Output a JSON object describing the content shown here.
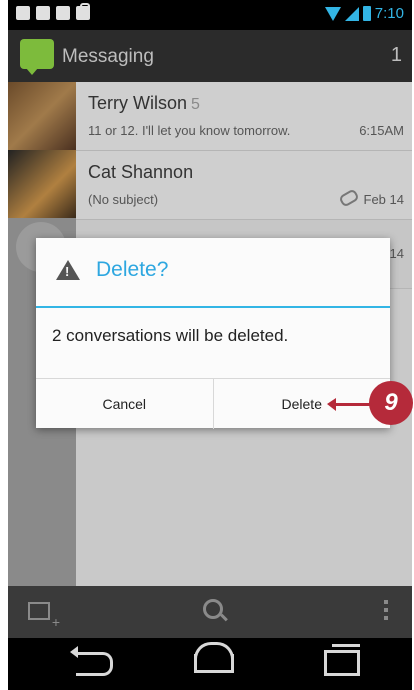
{
  "status_bar": {
    "time": "7:10",
    "icons": [
      "mail-icon",
      "voicemail-icon",
      "photo-icon",
      "shopping-bag-icon"
    ],
    "accent_color": "#33b5e5"
  },
  "action_bar": {
    "title": "Messaging",
    "count": "1"
  },
  "conversations": [
    {
      "name": "Terry Wilson",
      "count": "5",
      "snippet": "11 or 12. I'll let you know tomorrow.",
      "time": "6:15AM"
    },
    {
      "name": "Cat Shannon",
      "count": "",
      "snippet": "(No subject)",
      "time": "Feb 14"
    },
    {
      "name": "",
      "count": "",
      "snippet": "",
      "time": "14"
    }
  ],
  "dialog": {
    "title": "Delete?",
    "message": "2 conversations will be deleted.",
    "cancel_label": "Cancel",
    "delete_label": "Delete",
    "title_color": "#2ea7e0"
  },
  "callout": {
    "step": "9",
    "color": "#b52a3a"
  }
}
